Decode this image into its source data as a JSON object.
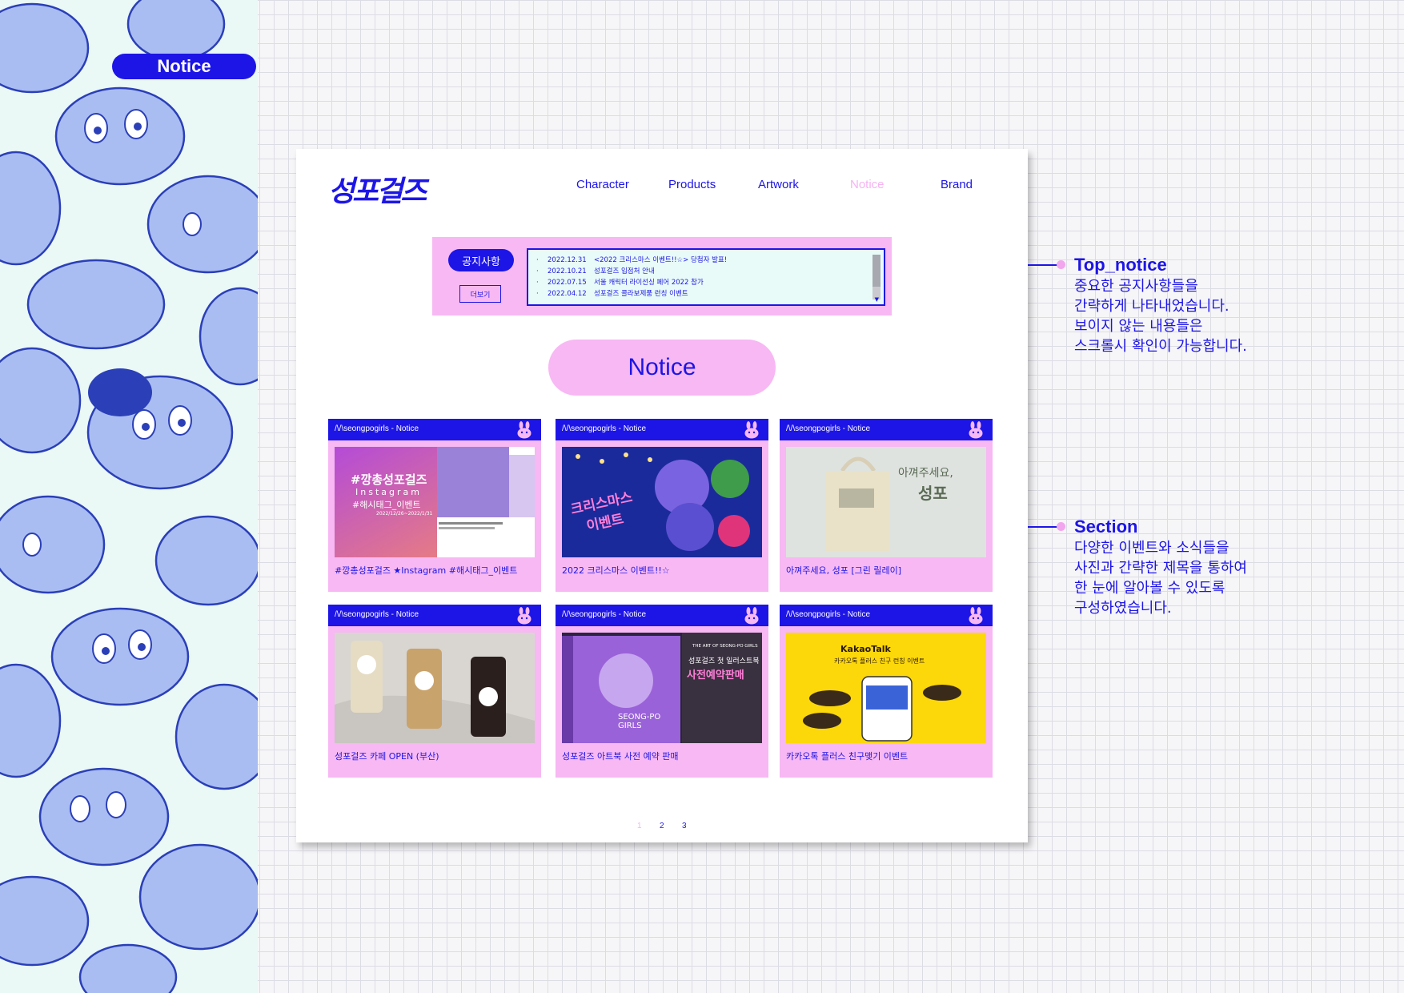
{
  "section_label": "Notice",
  "site": {
    "logo": "성포걸즈",
    "nav": [
      {
        "label": "Character",
        "active": false
      },
      {
        "label": "Products",
        "active": false
      },
      {
        "label": "Artwork",
        "active": false
      },
      {
        "label": "Notice",
        "active": true
      },
      {
        "label": "Brand",
        "active": false
      }
    ]
  },
  "top_notice": {
    "title": "공지사항",
    "more_label": "더보기",
    "items": [
      {
        "date": "2022.12.31",
        "text": "<2022 크리스마스 이벤트!!☆> 당첨자 발표!"
      },
      {
        "date": "2022.10.21",
        "text": "성포걸즈 입점처 안내"
      },
      {
        "date": "2022.07.15",
        "text": "서울 캐릭터 라이선싱 페어 2022 참가"
      },
      {
        "date": "2022.04.12",
        "text": "성포걸즈 콜라보제품 런칭 이벤트"
      }
    ]
  },
  "notice_heading": "Notice",
  "cards": [
    {
      "account": "/\\/\\seongpogirls - Notice",
      "caption": "#깡총성포걸즈 ★Instagram #해시태그_이벤트",
      "image": "instagram-event"
    },
    {
      "account": "/\\/\\seongpogirls - Notice",
      "caption": "2022 크리스마스 이벤트!!☆",
      "image": "christmas-event"
    },
    {
      "account": "/\\/\\seongpogirls - Notice",
      "caption": "아껴주세요, 성포 [그린 릴레이]",
      "image": "green-relay"
    },
    {
      "account": "/\\/\\seongpogirls - Notice",
      "caption": "성포걸즈 카페 OPEN (부산)",
      "image": "cafe-open"
    },
    {
      "account": "/\\/\\seongpogirls - Notice",
      "caption": "성포걸즈 아트북 사전 예약 판매",
      "image": "artbook"
    },
    {
      "account": "/\\/\\seongpogirls - Notice",
      "caption": "카카오톡 플러스 친구맺기 이벤트",
      "image": "kakao-event"
    }
  ],
  "image_text": {
    "insta_title": "#깡총성포걸즈",
    "insta_sub": "Instagram",
    "insta_tag": "#해시태그_이벤트",
    "insta_date": "2022/12/26~2022/1/31",
    "xmas_title": "크리스마스",
    "xmas_sub": "이벤트",
    "green_text1": "아껴주세요,",
    "green_text2": "성포",
    "art_top": "THE ART OF SEONG-PO GIRLS",
    "art_title": "성포걸즈 첫 일러스트북",
    "art_big": "사전예약판매",
    "art_side": "SEONG-PO GIRLS",
    "kakao_brand": "KakaoTalk",
    "kakao_title": "카카오톡 플러스 친구 런칭 이벤트"
  },
  "pagination": [
    {
      "label": "1",
      "active": true
    },
    {
      "label": "2",
      "active": false
    },
    {
      "label": "3",
      "active": false
    }
  ],
  "annotations": [
    {
      "title": "Top_notice",
      "body": "중요한 공지사항들을\n간략하게 나타내었습니다.\n보이지 않는 내용들은\n스크롤시 확인이 가능합니다."
    },
    {
      "title": "Section",
      "body": "다양한 이벤트와 소식들을\n사진과 간략한 제목을 통하여\n한 눈에 알아볼 수 있도록\n구성하였습니다."
    }
  ],
  "colors": {
    "brand_blue": "#1d15e6",
    "pink": "#f7b8f3",
    "mint": "#e8fbf8"
  }
}
